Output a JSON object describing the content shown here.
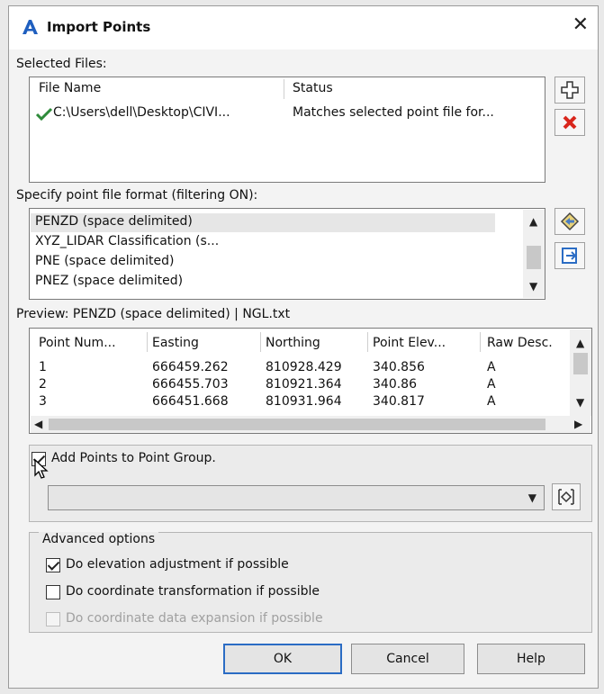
{
  "window": {
    "title": "Import Points",
    "close_glyph": "✕",
    "logo_icon": "autocad-logo-icon"
  },
  "selected_files": {
    "label": "Selected Files:",
    "columns": [
      "File Name",
      "Status"
    ],
    "rows": [
      {
        "file_name": "C:\\Users\\dell\\Desktop\\CIVI...",
        "status": "Matches selected point file for..."
      }
    ],
    "add_icon": "plus-icon",
    "remove_icon": "red-x-icon"
  },
  "format": {
    "label": "Specify point file format (filtering ON):",
    "items": [
      "PENZD (space delimited)",
      "XYZ_LIDAR Classification (s...",
      "PNE (space delimited)",
      "PNEZ (space delimited)"
    ],
    "selected_index": 0,
    "icons": [
      "format-manager-icon",
      "import-format-icon"
    ]
  },
  "preview": {
    "label": "Preview: PENZD (space delimited) | NGL.txt",
    "columns": [
      "Point Num...",
      "Easting",
      "Northing",
      "Point Elev...",
      "Raw Desc."
    ],
    "rows": [
      [
        "1",
        "666459.262",
        "810928.429",
        "340.856",
        "A"
      ],
      [
        "2",
        "666455.703",
        "810921.364",
        "340.86",
        "A"
      ],
      [
        "3",
        "666451.668",
        "810931.964",
        "340.817",
        "A"
      ]
    ]
  },
  "point_group": {
    "label": "Add Points to Point Group.",
    "checked": true,
    "combo_value": "",
    "pick_icon": "point-group-pick-icon"
  },
  "advanced": {
    "label": "Advanced options",
    "options": [
      {
        "label": "Do elevation adjustment if possible",
        "checked": true,
        "enabled": true
      },
      {
        "label": "Do coordinate transformation if possible",
        "checked": false,
        "enabled": true
      },
      {
        "label": "Do coordinate data expansion if possible",
        "checked": false,
        "enabled": false
      }
    ]
  },
  "buttons": {
    "ok": "OK",
    "cancel": "Cancel",
    "help": "Help"
  },
  "colors": {
    "accent": "#2b6cc4",
    "check_green": "#2e8b3a",
    "remove_red": "#d9261c"
  }
}
